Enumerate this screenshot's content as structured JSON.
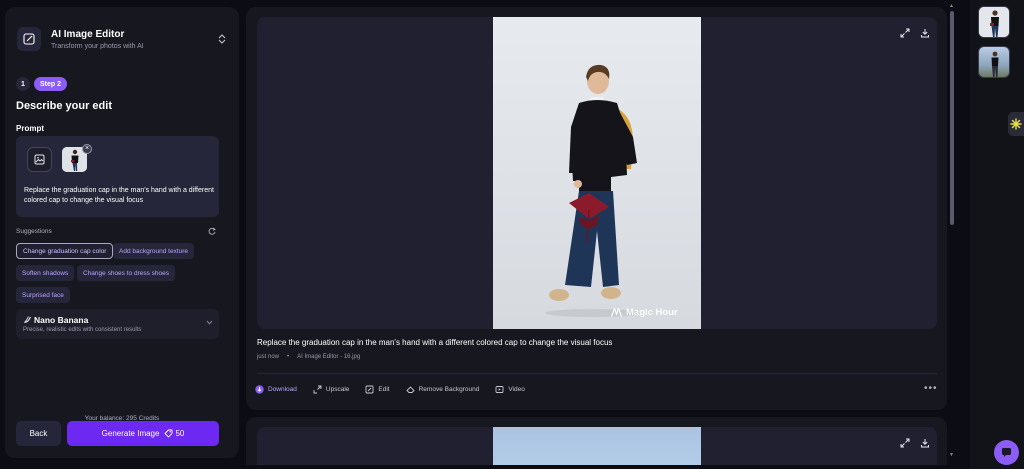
{
  "app": {
    "title": "AI Image Editor",
    "subtitle": "Transform your photos with AI"
  },
  "steps": {
    "step_one": "1",
    "step_two": "Step 2"
  },
  "editor": {
    "heading": "Describe your edit",
    "prompt_label": "Prompt",
    "prompt_text": "Replace the graduation cap in the man's hand with a different colored cap to change the visual focus",
    "suggestions_label": "Suggestions",
    "suggestions": [
      "Change graduation cap color",
      "Add background texture",
      "Soften shadows",
      "Change shoes to dress shoes",
      "Surprised face"
    ]
  },
  "model": {
    "name": "Nano Banana",
    "description": "Precise, realistic edits with consistent results"
  },
  "footer": {
    "balance": "Your balance: 295 Credits",
    "back_label": "Back",
    "generate_label": "Generate Image",
    "generate_cost": "50"
  },
  "result": {
    "caption": "Replace the graduation cap in the man's hand with a different colored cap to change the visual focus",
    "time": "just now",
    "separator": "•",
    "source": "AI Image Editor - 16.jpg",
    "watermark": "Magic Hour",
    "actions": {
      "download": "Download",
      "upscale": "Upscale",
      "edit": "Edit",
      "remove_bg": "Remove Background",
      "video": "Video"
    }
  },
  "colors": {
    "accent": "#8b5cf6",
    "generate": "#6d28f2",
    "panel": "#17171f",
    "background": "#0c0c14"
  }
}
